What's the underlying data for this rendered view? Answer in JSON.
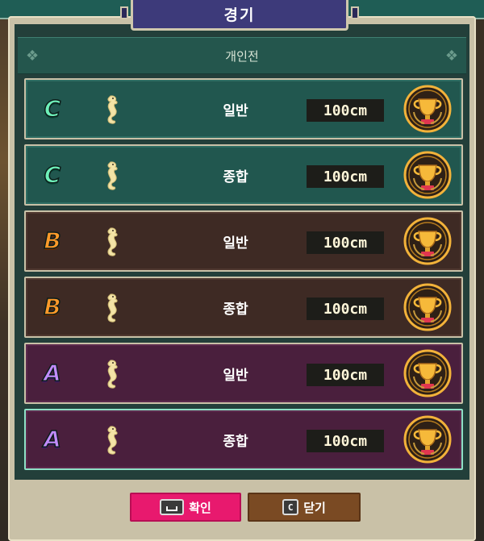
{
  "window": {
    "title": "경기"
  },
  "header": {
    "label": "개인전"
  },
  "rows": [
    {
      "grade": "C",
      "type": "일반",
      "size": "100cm",
      "theme": "c"
    },
    {
      "grade": "C",
      "type": "종합",
      "size": "100cm",
      "theme": "c"
    },
    {
      "grade": "B",
      "type": "일반",
      "size": "100cm",
      "theme": "b"
    },
    {
      "grade": "B",
      "type": "종합",
      "size": "100cm",
      "theme": "b"
    },
    {
      "grade": "A",
      "type": "일반",
      "size": "100cm",
      "theme": "a"
    },
    {
      "grade": "A",
      "type": "종합",
      "size": "100cm",
      "theme": "a"
    }
  ],
  "buttons": {
    "confirm_label": "확인",
    "close_key": "C",
    "close_label": "닫기"
  },
  "colors": {
    "confirm": "#e8196e",
    "close": "#7a4a23",
    "grade_c": "#6ef0b9",
    "grade_b": "#ff9a2a",
    "grade_a": "#c28cff"
  },
  "icons": {
    "species": "seahorse-icon",
    "reward": "trophy-icon"
  }
}
